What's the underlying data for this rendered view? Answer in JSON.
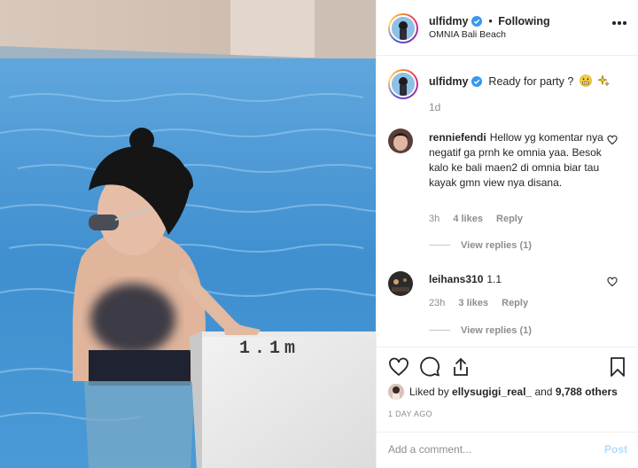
{
  "photo": {
    "sign_text": "1.1m"
  },
  "header": {
    "username": "ulfidmy",
    "separator": "•",
    "follow_status": "Following",
    "location": "OMNIA Bali Beach",
    "more_icon": "more-horizontal-icon",
    "verified_icon": "verified-badge-icon"
  },
  "caption": {
    "username": "ulfidmy",
    "text": "Ready for party ?",
    "emojis": [
      "grimacing-face-emoji",
      "sparkles-emoji"
    ],
    "time": "1d"
  },
  "comments": [
    {
      "username": "renniefendi",
      "text": "Hellow yg komentar nya negatif ga prnh ke omnia yaa. Besok kalo ke bali maen2 di omnia biar tau kayak gmn view nya disana.",
      "time": "3h",
      "likes": "4 likes",
      "reply_label": "Reply",
      "view_replies": "View replies (1)"
    },
    {
      "username": "leihans310",
      "text": "1.1",
      "time": "23h",
      "likes": "3 likes",
      "reply_label": "Reply",
      "view_replies": "View replies (1)"
    }
  ],
  "actions": {
    "icons": [
      "heart-icon",
      "comment-icon",
      "share-icon",
      "bookmark-icon"
    ],
    "liked_by_prefix": "Liked by",
    "liked_by_user": "ellysugigi_real_",
    "liked_by_and": "and",
    "liked_by_others": "9,788 others",
    "date": "1 DAY AGO"
  },
  "add_comment": {
    "placeholder": "Add a comment...",
    "post_label": "Post"
  },
  "colors": {
    "accent_blue": "#0095f6",
    "post_disabled": "#b3dbff",
    "verified": "#3897f0",
    "muted": "#8e8e8e",
    "border": "#efefef"
  }
}
